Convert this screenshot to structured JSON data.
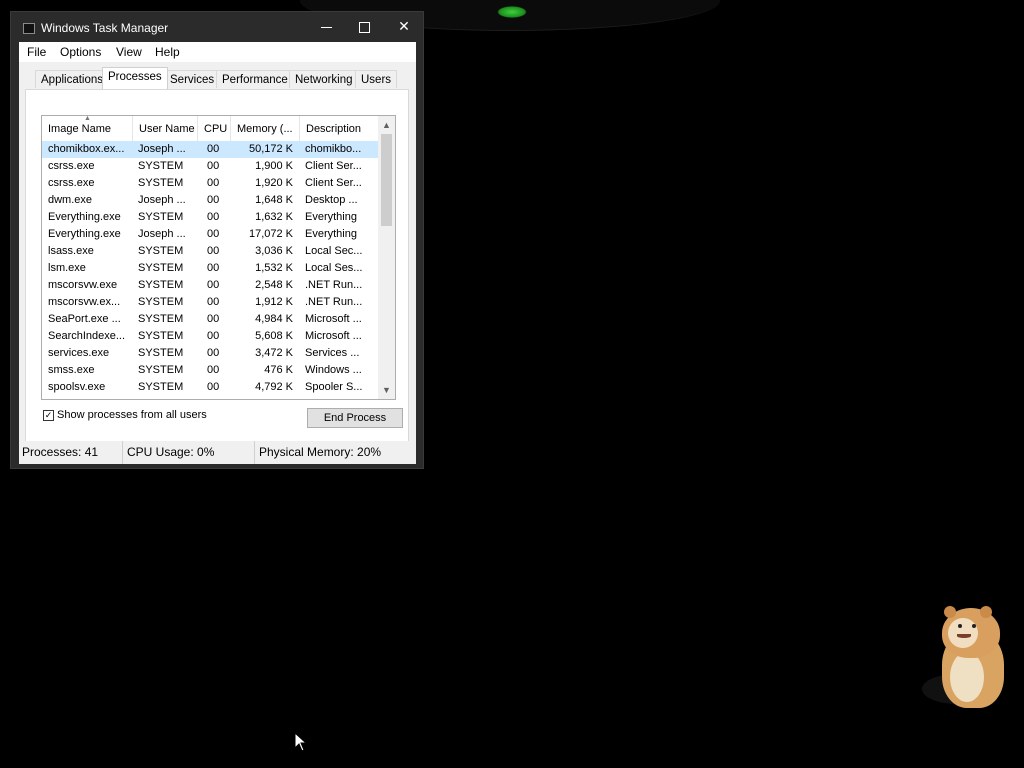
{
  "window": {
    "title": "Windows Task Manager",
    "controls": {
      "minimize": "minimize",
      "maximize": "maximize",
      "close": "✕"
    }
  },
  "menu": [
    "File",
    "Options",
    "View",
    "Help"
  ],
  "tabs": [
    "Applications",
    "Processes",
    "Services",
    "Performance",
    "Networking",
    "Users"
  ],
  "active_tab": "Processes",
  "columns": [
    "Image Name",
    "User Name",
    "CPU",
    "Memory (...",
    "Description"
  ],
  "processes": [
    {
      "name": "chomikbox.ex...",
      "user": "Joseph ...",
      "cpu": "00",
      "memory": "50,172 K",
      "description": "chomikbo...",
      "selected": true
    },
    {
      "name": "csrss.exe",
      "user": "SYSTEM",
      "cpu": "00",
      "memory": "1,900 K",
      "description": "Client Ser..."
    },
    {
      "name": "csrss.exe",
      "user": "SYSTEM",
      "cpu": "00",
      "memory": "1,920 K",
      "description": "Client Ser..."
    },
    {
      "name": "dwm.exe",
      "user": "Joseph ...",
      "cpu": "00",
      "memory": "1,648 K",
      "description": "Desktop ..."
    },
    {
      "name": "Everything.exe",
      "user": "SYSTEM",
      "cpu": "00",
      "memory": "1,632 K",
      "description": "Everything"
    },
    {
      "name": "Everything.exe",
      "user": "Joseph ...",
      "cpu": "00",
      "memory": "17,072 K",
      "description": "Everything"
    },
    {
      "name": "lsass.exe",
      "user": "SYSTEM",
      "cpu": "00",
      "memory": "3,036 K",
      "description": "Local Sec..."
    },
    {
      "name": "lsm.exe",
      "user": "SYSTEM",
      "cpu": "00",
      "memory": "1,532 K",
      "description": "Local Ses..."
    },
    {
      "name": "mscorsvw.exe",
      "user": "SYSTEM",
      "cpu": "00",
      "memory": "2,548 K",
      "description": ".NET Run..."
    },
    {
      "name": "mscorsvw.ex...",
      "user": "SYSTEM",
      "cpu": "00",
      "memory": "1,912 K",
      "description": ".NET Run..."
    },
    {
      "name": "SeaPort.exe ...",
      "user": "SYSTEM",
      "cpu": "00",
      "memory": "4,984 K",
      "description": "Microsoft ..."
    },
    {
      "name": "SearchIndexe...",
      "user": "SYSTEM",
      "cpu": "00",
      "memory": "5,608 K",
      "description": "Microsoft ..."
    },
    {
      "name": "services.exe",
      "user": "SYSTEM",
      "cpu": "00",
      "memory": "3,472 K",
      "description": "Services ..."
    },
    {
      "name": "smss.exe",
      "user": "SYSTEM",
      "cpu": "00",
      "memory": "476 K",
      "description": "Windows ..."
    },
    {
      "name": "spoolsv.exe",
      "user": "SYSTEM",
      "cpu": "00",
      "memory": "4,792 K",
      "description": "Spooler S..."
    }
  ],
  "show_all_users": {
    "label": "Show processes from all users",
    "checked": true
  },
  "end_process_label": "End Process",
  "status": {
    "processes": "Processes: 41",
    "cpu": "CPU Usage: 0%",
    "memory": "Physical Memory: 20%"
  },
  "colors": {
    "selection": "#cce8ff",
    "desktop": "#000000",
    "titlebar": "#2b2b2b"
  },
  "icons": {
    "app": "task-manager-icon",
    "check": "✓",
    "scroll_up": "▲",
    "scroll_down": "▼",
    "sort": "sort-ascending-icon"
  }
}
